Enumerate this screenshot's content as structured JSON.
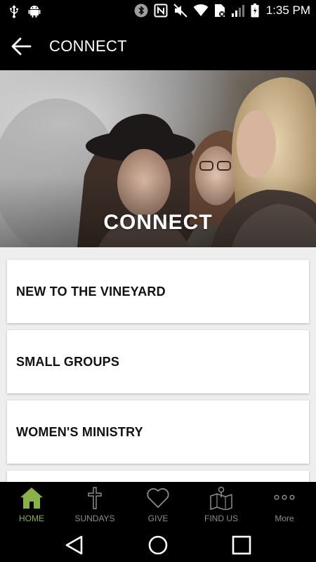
{
  "status_bar": {
    "time": "1:35 PM",
    "icons": [
      "usb-icon",
      "android-icon",
      "bluetooth-icon",
      "nfc-icon",
      "mute-icon",
      "wifi-icon",
      "sim-icon",
      "signal-icon",
      "battery-icon"
    ]
  },
  "app_bar": {
    "title": "CONNECT",
    "back_icon": "arrow-left-icon"
  },
  "hero": {
    "title": "CONNECT"
  },
  "cards": [
    {
      "label": "NEW TO THE VINEYARD"
    },
    {
      "label": "SMALL GROUPS"
    },
    {
      "label": "WOMEN'S MINISTRY"
    },
    {
      "label": ""
    }
  ],
  "bottom_nav": {
    "active_color": "#8ab04a",
    "inactive_color": "#8c8c8c",
    "items": [
      {
        "label": "HOME",
        "icon": "home-icon",
        "active": true
      },
      {
        "label": "SUNDAYS",
        "icon": "cross-icon",
        "active": false
      },
      {
        "label": "GIVE",
        "icon": "heart-icon",
        "active": false
      },
      {
        "label": "FIND US",
        "icon": "map-icon",
        "active": false
      },
      {
        "label": "More",
        "icon": "more-icon",
        "active": false
      }
    ]
  },
  "system_nav": {
    "buttons": [
      "back-triangle-icon",
      "home-circle-icon",
      "recents-square-icon"
    ]
  }
}
